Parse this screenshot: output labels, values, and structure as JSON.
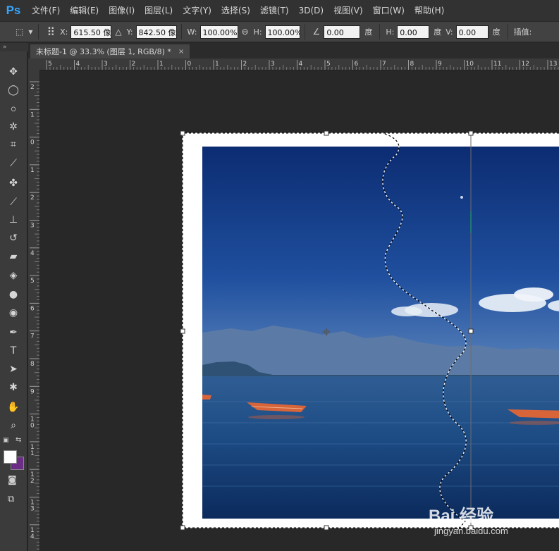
{
  "app": {
    "logo": "Ps",
    "menu": [
      "文件(F)",
      "编辑(E)",
      "图像(I)",
      "图层(L)",
      "文字(Y)",
      "选择(S)",
      "滤镜(T)",
      "3D(D)",
      "视图(V)",
      "窗口(W)",
      "帮助(H)"
    ]
  },
  "options": {
    "x_label": "X:",
    "x_value": "615.50 像",
    "y_label": "Y:",
    "y_value": "842.50 像",
    "w_label": "W:",
    "w_value": "100.00%",
    "h_label": "H:",
    "h_value": "100.00%",
    "angle_value": "0.00",
    "angle_unit": "度",
    "hskew_label": "H:",
    "hskew_value": "0.00",
    "hskew_unit": "度",
    "vskew_label": "V:",
    "vskew_value": "0.00",
    "vskew_unit": "度",
    "interp_label": "插值:"
  },
  "document": {
    "tab_title": "未标题-1 @ 33.3% (图层 1, RGB/8) *",
    "close_glyph": "×"
  },
  "panel_collapse_glyph": "»",
  "rulers": {
    "top_labels": [
      "5",
      "4",
      "3",
      "2",
      "1",
      "0",
      "1",
      "2",
      "3",
      "4",
      "5",
      "6",
      "7",
      "8",
      "9",
      "10",
      "11",
      "12",
      "13"
    ],
    "left_labels": [
      "2",
      "1",
      "0",
      "1",
      "2",
      "3",
      "4",
      "5",
      "6",
      "7",
      "8",
      "9",
      "10",
      "11",
      "12",
      "13",
      "14"
    ]
  },
  "tools": [
    {
      "name": "move-tool-icon",
      "glyph": "✥"
    },
    {
      "name": "elliptical-marquee-icon",
      "glyph": "◯"
    },
    {
      "name": "lasso-icon",
      "glyph": "ဝ"
    },
    {
      "name": "magic-wand-icon",
      "glyph": "✲"
    },
    {
      "name": "crop-icon",
      "glyph": "⌗"
    },
    {
      "name": "eyedropper-icon",
      "glyph": "⟋"
    },
    {
      "name": "healing-brush-icon",
      "glyph": "✤"
    },
    {
      "name": "brush-icon",
      "glyph": "⟋"
    },
    {
      "name": "clone-stamp-icon",
      "glyph": "⊥"
    },
    {
      "name": "history-brush-icon",
      "glyph": "↺"
    },
    {
      "name": "eraser-icon",
      "glyph": "▰"
    },
    {
      "name": "paint-bucket-icon",
      "glyph": "◈"
    },
    {
      "name": "blur-icon",
      "glyph": "●"
    },
    {
      "name": "dodge-icon",
      "glyph": "◉"
    },
    {
      "name": "pen-icon",
      "glyph": "✒"
    },
    {
      "name": "type-icon",
      "glyph": "T"
    },
    {
      "name": "path-selection-icon",
      "glyph": "➤"
    },
    {
      "name": "custom-shape-icon",
      "glyph": "✱"
    },
    {
      "name": "hand-icon",
      "glyph": "✋"
    },
    {
      "name": "zoom-icon",
      "glyph": "⌕"
    }
  ],
  "colors": {
    "foreground": "#ffffff",
    "background": "#6b2d86",
    "ps_blue": "#37a6ff"
  },
  "watermark": {
    "brand": "Bai 经验",
    "url": "jingyan.baidu.com"
  }
}
